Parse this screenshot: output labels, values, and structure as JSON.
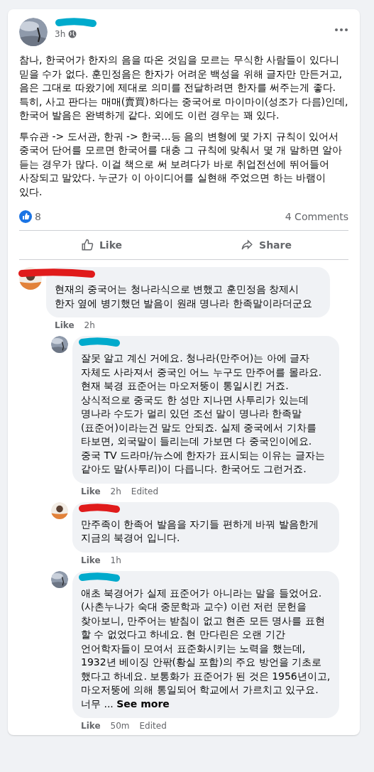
{
  "post": {
    "time": "3h",
    "paragraphs": [
      "참나, 한국어가 한자의 음을 따온 것임을 모르는 무식한 사람들이 있다니 믿을 수가 없다. 훈민정음은 한자가 어려운 백성을 위해 글자만 만든거고, 음은 그대로 따왔기에 제대로 의미를 전달하려면 한자를 써주는게 좋다. 특히, 사고 판다는 매매(賣買)하다는 중국어로 마이마이(성조가 다름)인데, 한국어 발음은 완벽하게 같다. 외에도 이런 경우는 꽤 있다.",
      "투슈관 -> 도서관, 한궈 -> 한국...등 음의 변형에 몇 가지 규칙이 있어서 중국어 단어를 모르면 한국어를 대충 그 규칙에 맞춰서 몇 개 말하면 알아 듣는 경우가 많다. 이걸 책으로 써 보려다가 바로 취업전선에 뛰어들어 사장되고 말았다. 누군가 이 아이디어를 실현해 주었으면 하는 바램이 있다."
    ],
    "reactions": "8",
    "comments_count": "4 Comments",
    "actions": [
      {
        "kind": "like",
        "label": "Like"
      },
      {
        "kind": "share",
        "label": "Share"
      }
    ]
  },
  "comments": [
    {
      "kind": "top",
      "text": "현재의 중국어는 청나라식으로 변했고 훈민정음 창제시 한자 옆에 병기했던 발음이 원래 명나라 한족말이라더군요",
      "like": "Like",
      "time": "2h"
    },
    {
      "kind": "reply",
      "text": "잘못 알고 계신 거에요. 청나라(만주어)는 아에 글자 자체도 사라져서 중국인 어느 누구도 만주어를 몰라요. 현재 북경 표준어는 마오저뚱이 통일시킨 거죠. 상식적으로 중국도 한 성만 지나면 사투리가 있는데 명나라 수도가 멀리 있던 조선 말이 명나라 한족말(표준어)이라는건 말도 안되죠. 실제 중국에서 기차를 타보면, 외국말이 들리는데 가보면 다 중국인이에요. 중국 TV 드라마/뉴스에 한자가 표시되는 이유는 글자는 같아도 말(사투리)이 다릅니다. 한국어도 그런거죠.",
      "like": "Like",
      "time": "2h",
      "edited": "Edited"
    },
    {
      "kind": "reply",
      "text": "만주족이 한족어 발음을 자기들 편하게 바꿔 발음한게 지금의 북경어 입니다.",
      "like": "Like",
      "time": "1h"
    },
    {
      "kind": "reply",
      "text": "애초 북경어가 실제 표준어가 아니라는 말을 들었어요. (사촌누나가 숙대 중문학과 교수) 이런 저런 문헌을 찾아보니, 만주어는 받침이 없고 현존 모든 명사를 표현 할 수 없었다고 하네요. 현 만다린은 오랜 기간 언어학자들이 모여서 표준화시키는 노력을 했는데, 1932년 베이징 안팎(황실 포함)의 주요 방언을 기초로 했다고 하네요. 보통화가 표준어가 된 것은 1956년이고, 마오저뚱에 의해 통일되어 학교에서 가르치고 있구요. 너무 ...",
      "see_more": "See more",
      "like": "Like",
      "time": "50m",
      "edited": "Edited"
    }
  ]
}
